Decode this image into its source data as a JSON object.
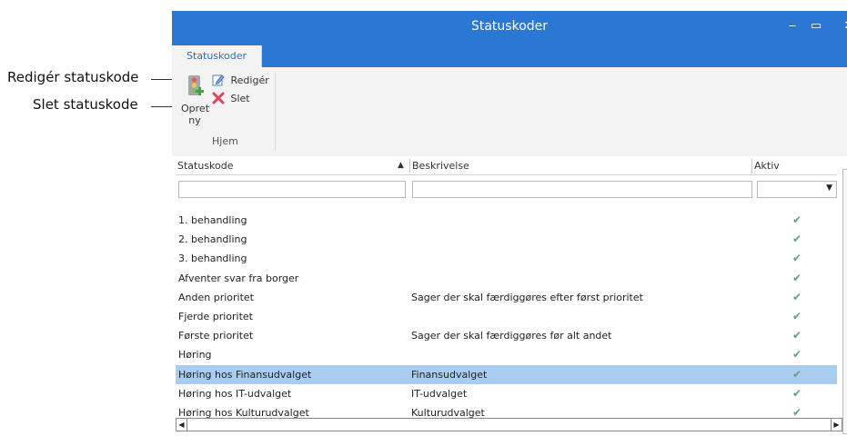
{
  "callouts": {
    "edit": "Redigér statuskode",
    "delete": "Slet statuskode"
  },
  "window": {
    "title": "Statuskoder",
    "minimize": "‒",
    "maximize": "▭",
    "close": "✕"
  },
  "tabs": {
    "active": "Statuskoder"
  },
  "ribbon": {
    "create_label_1": "Opret",
    "create_label_2": "ny",
    "edit_label": "Redigér",
    "delete_label": "Slet",
    "group_label": "Hjem"
  },
  "grid": {
    "columns": {
      "statuskode": "Statuskode",
      "beskrivelse": "Beskrivelse",
      "aktiv": "Aktiv"
    },
    "sort_indicator": "▲",
    "filter_dropdown": "▼",
    "check": "✔",
    "rows": [
      {
        "statuskode": "1. behandling",
        "beskrivelse": "",
        "aktiv": true
      },
      {
        "statuskode": "2. behandling",
        "beskrivelse": "",
        "aktiv": true
      },
      {
        "statuskode": "3. behandling",
        "beskrivelse": "",
        "aktiv": true
      },
      {
        "statuskode": "Afventer svar fra borger",
        "beskrivelse": "",
        "aktiv": true
      },
      {
        "statuskode": "Anden prioritet",
        "beskrivelse": "Sager der skal færdiggøres efter først prioritet",
        "aktiv": true
      },
      {
        "statuskode": "Fjerde prioritet",
        "beskrivelse": "",
        "aktiv": true
      },
      {
        "statuskode": "Første prioritet",
        "beskrivelse": "Sager der skal færdiggøres før alt andet",
        "aktiv": true
      },
      {
        "statuskode": "Høring",
        "beskrivelse": "",
        "aktiv": true
      },
      {
        "statuskode": "Høring hos Finansudvalget",
        "beskrivelse": "Finansudvalget",
        "aktiv": true,
        "selected": true
      },
      {
        "statuskode": "Høring hos IT-udvalget",
        "beskrivelse": "IT-udvalget",
        "aktiv": true
      },
      {
        "statuskode": "Høring hos Kulturudvalget",
        "beskrivelse": "Kulturudvalget",
        "aktiv": true
      }
    ]
  },
  "colors": {
    "titlebar": "#2b78d4",
    "selection": "#a8cdf0",
    "check": "#5aa37a",
    "delete_x": "#e0455c"
  }
}
